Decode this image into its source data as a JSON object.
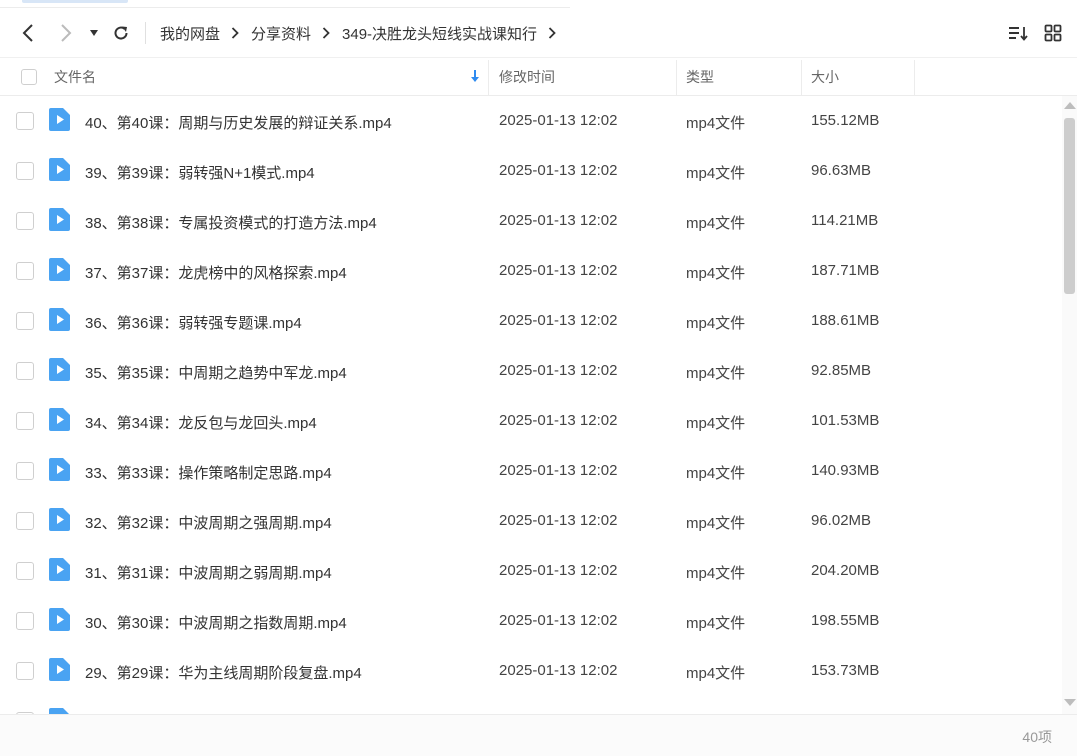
{
  "toolbar": {
    "back_icon": "chevron-left-icon",
    "forward_icon": "chevron-right-icon",
    "dropdown_icon": "caret-down-icon",
    "refresh_icon": "refresh-icon",
    "sort_icon": "sort-list-icon",
    "grid_icon": "grid-view-icon"
  },
  "breadcrumb": [
    {
      "label": "我的网盘"
    },
    {
      "label": "分享资料"
    },
    {
      "label": "349-决胜龙头短线实战课知行"
    }
  ],
  "columns": {
    "name": "文件名",
    "mtime": "修改时间",
    "type": "类型",
    "size": "大小"
  },
  "files": [
    {
      "name": "40、第40课：周期与历史发展的辩证关系.mp4",
      "mtime": "2025-01-13 12:02",
      "type": "mp4文件",
      "size": "155.12MB"
    },
    {
      "name": "39、第39课：弱转强N+1模式.mp4",
      "mtime": "2025-01-13 12:02",
      "type": "mp4文件",
      "size": "96.63MB"
    },
    {
      "name": "38、第38课：专属投资模式的打造方法.mp4",
      "mtime": "2025-01-13 12:02",
      "type": "mp4文件",
      "size": "114.21MB"
    },
    {
      "name": "37、第37课：龙虎榜中的风格探索.mp4",
      "mtime": "2025-01-13 12:02",
      "type": "mp4文件",
      "size": "187.71MB"
    },
    {
      "name": "36、第36课：弱转强专题课.mp4",
      "mtime": "2025-01-13 12:02",
      "type": "mp4文件",
      "size": "188.61MB"
    },
    {
      "name": "35、第35课：中周期之趋势中军龙.mp4",
      "mtime": "2025-01-13 12:02",
      "type": "mp4文件",
      "size": "92.85MB"
    },
    {
      "name": "34、第34课：龙反包与龙回头.mp4",
      "mtime": "2025-01-13 12:02",
      "type": "mp4文件",
      "size": "101.53MB"
    },
    {
      "name": "33、第33课：操作策略制定思路.mp4",
      "mtime": "2025-01-13 12:02",
      "type": "mp4文件",
      "size": "140.93MB"
    },
    {
      "name": "32、第32课：中波周期之强周期.mp4",
      "mtime": "2025-01-13 12:02",
      "type": "mp4文件",
      "size": "96.02MB"
    },
    {
      "name": "31、第31课：中波周期之弱周期.mp4",
      "mtime": "2025-01-13 12:02",
      "type": "mp4文件",
      "size": "204.20MB"
    },
    {
      "name": "30、第30课：中波周期之指数周期.mp4",
      "mtime": "2025-01-13 12:02",
      "type": "mp4文件",
      "size": "198.55MB"
    },
    {
      "name": "29、第29课：华为主线周期阶段复盘.mp4",
      "mtime": "2025-01-13 12:02",
      "type": "mp4文件",
      "size": "153.73MB"
    },
    {
      "name": "",
      "mtime": "",
      "type": "",
      "size": ""
    }
  ],
  "footer": {
    "count": "40项"
  },
  "colors": {
    "accent": "#2f8bf0",
    "file_icon": "#4aa3f2"
  }
}
